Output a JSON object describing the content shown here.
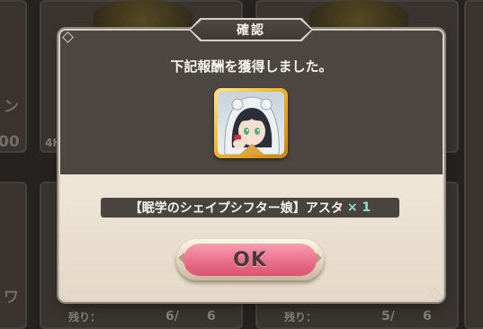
{
  "dialog": {
    "title": "確認",
    "message": "下記報酬を獲得しました。",
    "reward": {
      "name": "【眠学のシェイプシフター娘】アスタ",
      "quantity": "× 1"
    },
    "ok_label": "OK"
  },
  "background": {
    "left_cards": [
      {
        "text": "ン"
      },
      {
        "text": "00"
      },
      {
        "text": "ワ"
      }
    ],
    "middle_card_top_label": "4H",
    "remaining_rows": [
      {
        "label": "残り：",
        "value": "6/",
        "total": "6"
      },
      {
        "label": "残り：",
        "value": "5/",
        "total": "6"
      }
    ]
  },
  "colors": {
    "dialog_dark": "#4d4744",
    "dialog_light": "#efe6d8",
    "ok_button": "#ea6f8b",
    "quantity_accent": "#8fe0d0",
    "reward_frame_gold": "#f0b52c"
  },
  "icons": [
    "diamond-corner-icon",
    "reward-character-portrait",
    "sparkle-icon"
  ]
}
